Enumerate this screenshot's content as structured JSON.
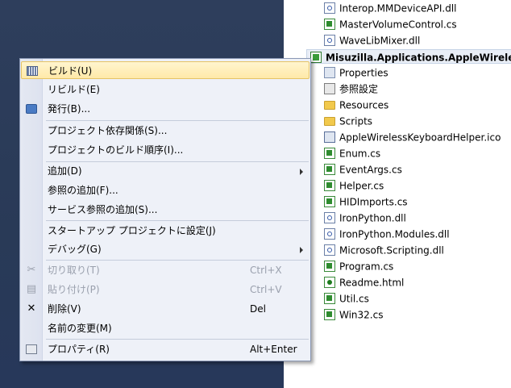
{
  "solution_explorer": {
    "items": [
      {
        "label": "Interop.MMDeviceAPI.dll",
        "icon": "reference-icon"
      },
      {
        "label": "MasterVolumeControl.cs",
        "icon": "csharp-file-icon"
      },
      {
        "label": "WaveLibMixer.dll",
        "icon": "reference-icon"
      },
      {
        "label": "Misuzilla.Applications.AppleWireles",
        "icon": "csharp-project-icon"
      },
      {
        "label": "Properties",
        "icon": "properties-icon"
      },
      {
        "label": "参照設定",
        "icon": "references-icon"
      },
      {
        "label": "Resources",
        "icon": "folder-icon"
      },
      {
        "label": "Scripts",
        "icon": "folder-icon"
      },
      {
        "label": "AppleWirelessKeyboardHelper.ico",
        "icon": "ico-file-icon"
      },
      {
        "label": "Enum.cs",
        "icon": "csharp-file-icon"
      },
      {
        "label": "EventArgs.cs",
        "icon": "csharp-file-icon"
      },
      {
        "label": "Helper.cs",
        "icon": "csharp-file-icon"
      },
      {
        "label": "HIDImports.cs",
        "icon": "csharp-file-icon"
      },
      {
        "label": "IronPython.dll",
        "icon": "reference-icon"
      },
      {
        "label": "IronPython.Modules.dll",
        "icon": "reference-icon"
      },
      {
        "label": "Microsoft.Scripting.dll",
        "icon": "reference-icon"
      },
      {
        "label": "Program.cs",
        "icon": "csharp-file-icon"
      },
      {
        "label": "Readme.html",
        "icon": "html-file-icon"
      },
      {
        "label": "Util.cs",
        "icon": "csharp-file-icon"
      },
      {
        "label": "Win32.cs",
        "icon": "csharp-file-icon"
      }
    ]
  },
  "context_menu": {
    "items": [
      {
        "label": "ビルド(U)",
        "shortcut": "",
        "icon": "build-icon",
        "highlighted": true
      },
      {
        "label": "リビルド(E)",
        "shortcut": ""
      },
      {
        "label": "発行(B)...",
        "shortcut": "",
        "icon": "publish-icon"
      },
      {
        "label": "プロジェクト依存関係(S)...",
        "shortcut": ""
      },
      {
        "label": "プロジェクトのビルド順序(I)...",
        "shortcut": ""
      },
      {
        "label": "追加(D)",
        "shortcut": "",
        "submenu": true
      },
      {
        "label": "参照の追加(F)...",
        "shortcut": ""
      },
      {
        "label": "サービス参照の追加(S)...",
        "shortcut": ""
      },
      {
        "label": "スタートアップ プロジェクトに設定(J)",
        "shortcut": ""
      },
      {
        "label": "デバッグ(G)",
        "shortcut": "",
        "submenu": true
      },
      {
        "label": "切り取り(T)",
        "shortcut": "Ctrl+X",
        "icon": "scissors-icon",
        "disabled": true
      },
      {
        "label": "貼り付け(P)",
        "shortcut": "Ctrl+V",
        "icon": "paste-icon",
        "disabled": true
      },
      {
        "label": "削除(V)",
        "shortcut": "Del",
        "icon": "delete-icon"
      },
      {
        "label": "名前の変更(M)",
        "shortcut": ""
      },
      {
        "label": "プロパティ(R)",
        "shortcut": "Alt+Enter",
        "icon": "properties-icon"
      }
    ]
  }
}
